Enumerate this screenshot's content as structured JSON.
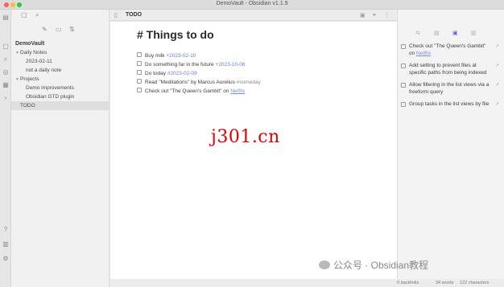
{
  "window": {
    "title": "DemoVault - Obsidian v1.1.9"
  },
  "sidebar": {
    "vault_name": "DemoVault",
    "tree": [
      {
        "label": "Daily Notes",
        "depth": 1,
        "folder": true
      },
      {
        "label": "2023-02-11",
        "depth": 2,
        "folder": false
      },
      {
        "label": "not a daily note",
        "depth": 2,
        "folder": false
      },
      {
        "label": "Projects",
        "depth": 1,
        "folder": true
      },
      {
        "label": "Demo improvements",
        "depth": 2,
        "folder": false
      },
      {
        "label": "Obsidian GTD plugin",
        "depth": 2,
        "folder": false
      },
      {
        "label": "TODO",
        "depth": 1,
        "folder": false,
        "selected": true
      }
    ]
  },
  "tab": {
    "title": "TODO"
  },
  "editor": {
    "heading": "# Things to do",
    "tasks": [
      {
        "text": "Buy milk ",
        "date": "+2023-02-10",
        "tag": "",
        "link": "",
        "suffix": ""
      },
      {
        "text": "Do something far in the future ",
        "date": "+2023-10-06",
        "tag": "",
        "link": "",
        "suffix": ""
      },
      {
        "text": "Do today ",
        "date": "#2023-02-09",
        "tag": "",
        "link": "",
        "suffix": ""
      },
      {
        "text": "Read \"Meditations\" by Marcus Aurelius ",
        "date": "",
        "tag": "#someday",
        "link": "",
        "suffix": ""
      },
      {
        "text": "Check out \"The Queen's Gambit\" on ",
        "date": "",
        "tag": "",
        "link": "Netflix",
        "suffix": ""
      }
    ]
  },
  "watermark_text": "j301.cn",
  "right_panel": {
    "items": [
      {
        "text": "Check out \"The Queen's Gambit\" on ",
        "link": "Netflix"
      },
      {
        "text": "Add setting to prevent files at specific paths from being indexed",
        "link": ""
      },
      {
        "text": "Allow filtering in the list views via a freeform query",
        "link": ""
      },
      {
        "text": "Group tasks in the list views by file",
        "link": ""
      }
    ]
  },
  "status": {
    "backlinks": "0 backlinks",
    "words": "34 words",
    "characters": "122 characters"
  },
  "footer_watermark": "公众号 · Obsidian教程",
  "colors": {
    "accent": "#5b6bd0",
    "date": "#6b7bd6",
    "watermark": "#e30000"
  }
}
